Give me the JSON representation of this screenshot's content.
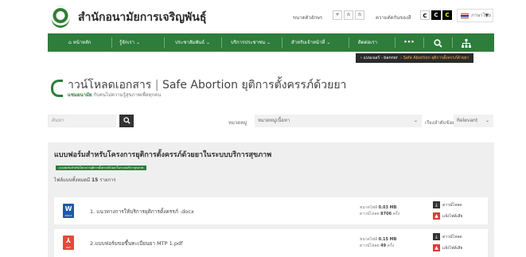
{
  "header": {
    "site_title": "สำนักอนามัยการเจริญพันธุ์",
    "font_size_label": "ขนาดตัวอักษร",
    "font_size_buttons": [
      "+",
      "ก",
      "ก"
    ],
    "contrast_label": "ความตัดกันของสี",
    "contrast_buttons": [
      "C",
      "C",
      "C"
    ],
    "language": "ภาษาไทย"
  },
  "nav": {
    "items": [
      "หน้าหลัก",
      "รู้จักเรา",
      "ประชาสัมพันธ์",
      "บริการประชาชน",
      "สำหรับเจ้าหน้าที่",
      "ติดต่อเรา"
    ],
    "more": "•••"
  },
  "breadcrumb": {
    "home": "แบนเนอร์ - banner",
    "current": "Safe Abortion ยุติการตั้งครรภ์ด้วยยา"
  },
  "page": {
    "title_thai": "าวน์โหลดเอกสาร",
    "title_sep": "|",
    "title_topic": "Safe Abortion ยุติการตั้งครรภ์ด้วยยา",
    "subtitle_brand": "แชมอนามัย",
    "subtitle_text": "กับคนไม่ความรู้สุขภาพเพื่อทุกคน"
  },
  "filters": {
    "search_placeholder": "ค้นหา",
    "category_label": "หมวดหมู่",
    "category_value": "หมวดหมู่เนื้อหา",
    "sort_label": "เรียงลำดับข้อมูล",
    "sort_value": "Relevant"
  },
  "panel": {
    "title": "แบบฟอร์มสำหรับโครงการยุติการตั้งครรภ์ด้วยยาในระบบบริการสุขภาพ",
    "tag": "แบบฟอร์มสำหรับโครงการยุติการตั้งครรภ์ด้วยยาในระบบบริการสุขภาพ",
    "count_prefix": "ไฟล์แบบทั้งหมดมี",
    "count": "15",
    "count_suffix": "รายการ",
    "files": [
      {
        "icon": "word-file-icon",
        "name": "1. แนวทางการให้บริการยุติการตั้งครรภ์ .docx",
        "size_label": "ขนาดไฟล์",
        "size": "0.03 MB",
        "downloads_label": "ดาวน์โหลด",
        "downloads": "8706",
        "downloads_unit": "ครั้ง",
        "download_btn": "ดาวน์โหลด",
        "report_btn": "แจ้งไฟล์เสีย"
      },
      {
        "icon": "pdf-file-icon",
        "name": "2.แบบฟอร์มขอขึ้นทะเบียนยา MTP 1.pdf",
        "size_label": "ขนาดไฟล์",
        "size": "0.15 MB",
        "downloads_label": "ดาวน์โหลด",
        "downloads": "49",
        "downloads_unit": "ครั้ง",
        "download_btn": "ดาวน์โหลด",
        "report_btn": "แจ้งไฟล์เสีย"
      }
    ]
  },
  "colors": {
    "brand_green": "#2e7d3a",
    "word_blue": "#1e5aa8",
    "pdf_red": "#e64a3b",
    "report_red": "#e53935"
  }
}
